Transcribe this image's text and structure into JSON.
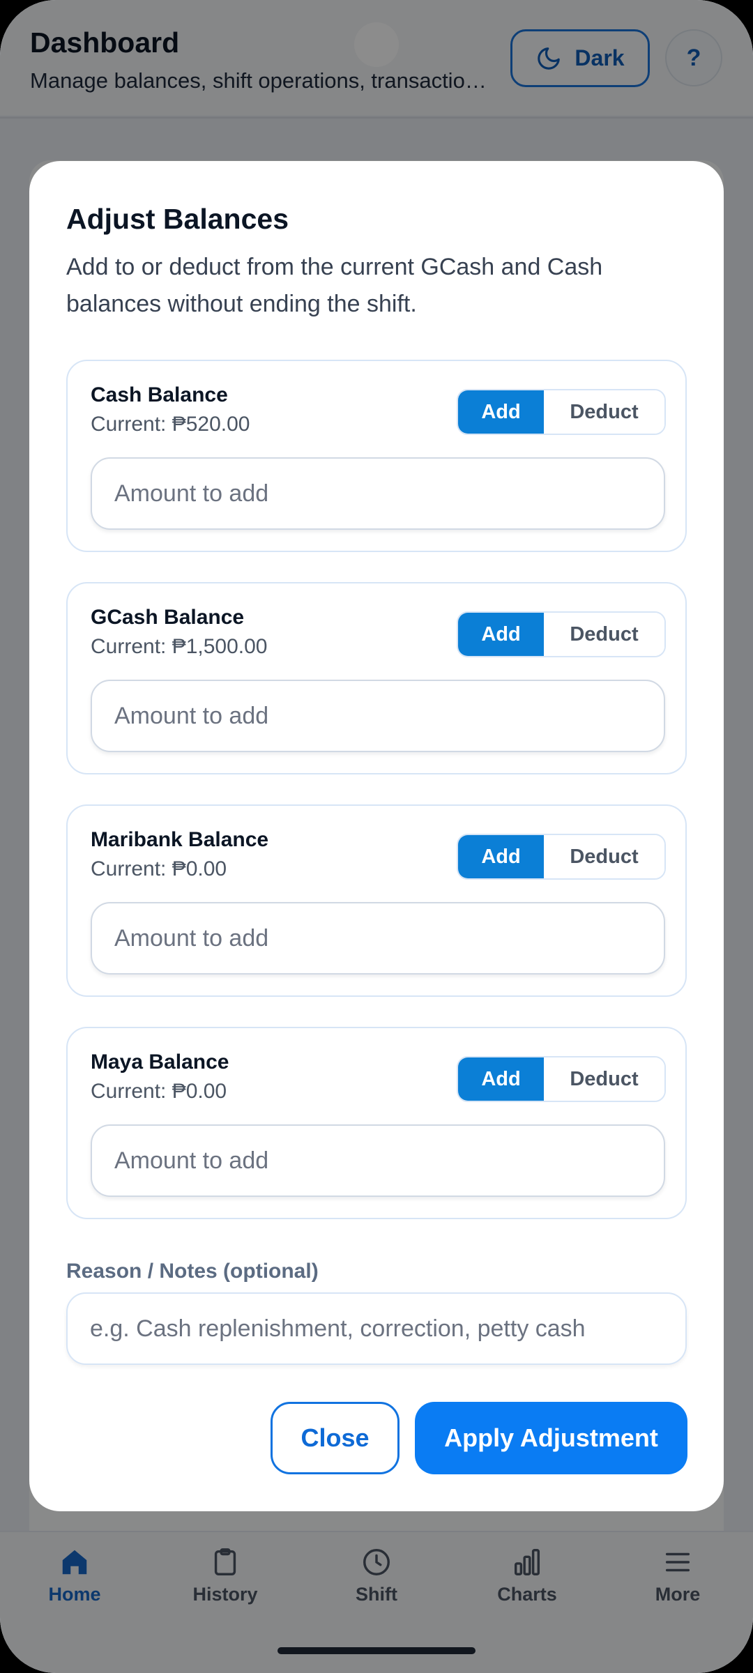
{
  "header": {
    "title": "Dashboard",
    "subtitle": "Manage balances, shift operations, transactions and more",
    "theme_button_label": "Dark",
    "help_button_label": "?"
  },
  "modal": {
    "title": "Adjust Balances",
    "description": "Add to or deduct from the current GCash and Cash balances without ending the shift.",
    "balances": [
      {
        "name": "Cash Balance",
        "current": "Current: ₱520.00",
        "add_label": "Add",
        "deduct_label": "Deduct",
        "mode": "add",
        "placeholder": "Amount to add",
        "value": ""
      },
      {
        "name": "GCash Balance",
        "current": "Current: ₱1,500.00",
        "add_label": "Add",
        "deduct_label": "Deduct",
        "mode": "add",
        "placeholder": "Amount to add",
        "value": ""
      },
      {
        "name": "Maribank Balance",
        "current": "Current: ₱0.00",
        "add_label": "Add",
        "deduct_label": "Deduct",
        "mode": "add",
        "placeholder": "Amount to add",
        "value": ""
      },
      {
        "name": "Maya Balance",
        "current": "Current: ₱0.00",
        "add_label": "Add",
        "deduct_label": "Deduct",
        "mode": "add",
        "placeholder": "Amount to add",
        "value": ""
      }
    ],
    "notes_label": "Reason / Notes (optional)",
    "notes_placeholder": "e.g. Cash replenishment, correction, petty cash",
    "close_label": "Close",
    "apply_label": "Apply Adjustment"
  },
  "bottom_nav": {
    "items": [
      {
        "label": "Home",
        "icon": "home-icon",
        "active": true
      },
      {
        "label": "History",
        "icon": "clipboard-icon",
        "active": false
      },
      {
        "label": "Shift",
        "icon": "clock-icon",
        "active": false
      },
      {
        "label": "Charts",
        "icon": "bar-chart-icon",
        "active": false
      },
      {
        "label": "More",
        "icon": "menu-icon",
        "active": false
      }
    ]
  },
  "colors": {
    "accent": "#0a7cf3",
    "toggle_active": "#0b7fd6",
    "nav_active": "#1767c7"
  }
}
